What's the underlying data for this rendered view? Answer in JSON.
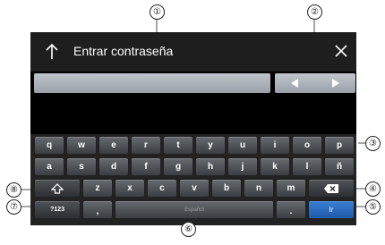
{
  "header": {
    "title": "Entrar contraseña"
  },
  "keyboard": {
    "row1": [
      "q",
      "w",
      "e",
      "r",
      "t",
      "y",
      "u",
      "i",
      "o",
      "p"
    ],
    "row2": [
      "a",
      "s",
      "d",
      "f",
      "g",
      "h",
      "j",
      "k",
      "l",
      "ñ"
    ],
    "row3": [
      "z",
      "x",
      "c",
      "v",
      "b",
      "n",
      "m"
    ],
    "comma": ",",
    "period": ".",
    "space_label": "Español",
    "numbers_label": "?123",
    "enter_label": "Ir"
  },
  "callouts": [
    "①",
    "②",
    "③",
    "④",
    "⑤",
    "⑥",
    "⑦",
    "⑧"
  ],
  "colors": {
    "enter_key": "#2a6cc0",
    "keyboard_bg": "#222222",
    "header_bg": "#1e1e1e"
  }
}
